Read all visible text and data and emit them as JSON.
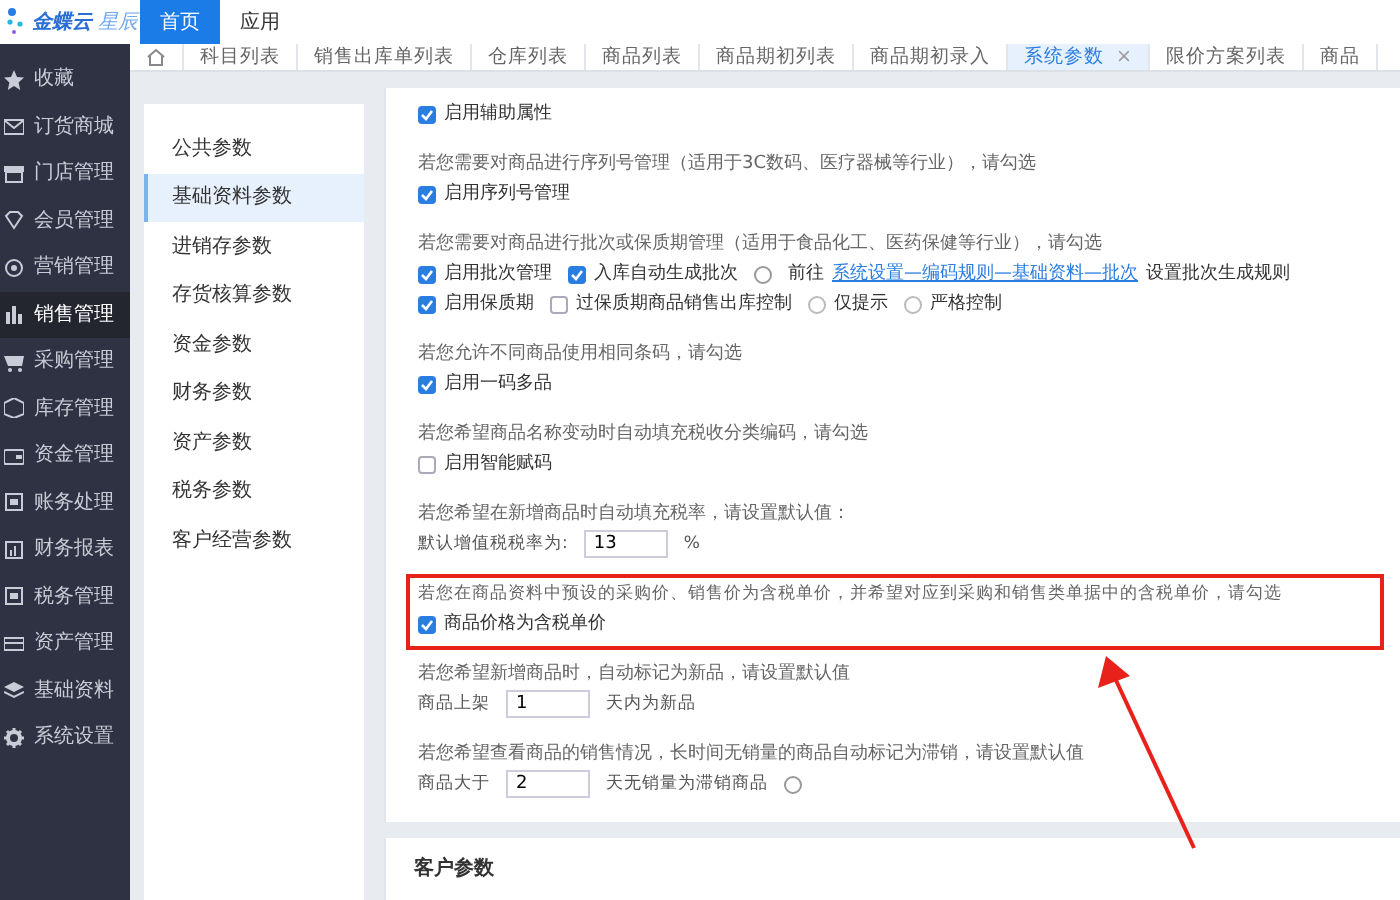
{
  "logo": {
    "name": "金蝶云",
    "edition": "星辰"
  },
  "top_tabs": [
    {
      "label": "首页",
      "selected": true
    },
    {
      "label": "应用",
      "selected": false
    }
  ],
  "sidebar": {
    "items": [
      {
        "label": "收藏",
        "selected": false
      },
      {
        "label": "订货商城",
        "selected": false
      },
      {
        "label": "门店管理",
        "selected": false
      },
      {
        "label": "会员管理",
        "selected": false
      },
      {
        "label": "营销管理",
        "selected": false
      },
      {
        "label": "销售管理",
        "selected": true
      },
      {
        "label": "采购管理",
        "selected": false
      },
      {
        "label": "库存管理",
        "selected": false
      },
      {
        "label": "资金管理",
        "selected": false
      },
      {
        "label": "账务处理",
        "selected": false
      },
      {
        "label": "财务报表",
        "selected": false
      },
      {
        "label": "税务管理",
        "selected": false
      },
      {
        "label": "资产管理",
        "selected": false
      },
      {
        "label": "基础资料",
        "selected": false
      },
      {
        "label": "系统设置",
        "selected": false
      }
    ]
  },
  "page_tabs": [
    {
      "label": "科目列表",
      "selected": false
    },
    {
      "label": "销售出库单列表",
      "selected": false
    },
    {
      "label": "仓库列表",
      "selected": false
    },
    {
      "label": "商品列表",
      "selected": false
    },
    {
      "label": "商品期初列表",
      "selected": false
    },
    {
      "label": "商品期初录入",
      "selected": false
    },
    {
      "label": "系统参数",
      "selected": true,
      "close": "×"
    },
    {
      "label": "限价方案列表",
      "selected": false
    },
    {
      "label": "商品",
      "selected": false
    }
  ],
  "param_nav": [
    {
      "label": "公共参数",
      "selected": false
    },
    {
      "label": "基础资料参数",
      "selected": true
    },
    {
      "label": "进销存参数",
      "selected": false
    },
    {
      "label": "存货核算参数",
      "selected": false
    },
    {
      "label": "资金参数",
      "selected": false
    },
    {
      "label": "财务参数",
      "selected": false
    },
    {
      "label": "资产参数",
      "selected": false
    },
    {
      "label": "税务参数",
      "selected": false
    },
    {
      "label": "客户经营参数",
      "selected": false
    }
  ],
  "settings": [
    {
      "rows": [
        [
          {
            "kind": "checkbox",
            "label": "启用辅助属性",
            "checked": true
          }
        ]
      ]
    },
    {
      "hint": "若您需要对商品进行序列号管理（适用于3C数码、医疗器械等行业），请勾选",
      "rows": [
        [
          {
            "kind": "checkbox",
            "label": "启用序列号管理",
            "checked": true
          }
        ]
      ]
    },
    {
      "hint": "若您需要对商品进行批次或保质期管理（适用于食品化工、医药保健等行业），请勾选",
      "rows": [
        [
          {
            "kind": "checkbox",
            "label": "启用批次管理",
            "checked": true
          },
          {
            "kind": "checkbox",
            "label": "入库自动生成批次",
            "checked": true
          },
          {
            "kind": "help"
          },
          {
            "kind": "link",
            "before": "前往",
            "link": "系统设置—编码规则—基础资料—批次",
            "after": "设置批次生成规则"
          }
        ],
        [
          {
            "kind": "checkbox",
            "label": "启用保质期",
            "checked": true
          },
          {
            "kind": "checkbox",
            "label": "过保质期商品销售出库控制",
            "checked": false
          },
          {
            "kind": "radio",
            "label": "仅提示",
            "selected": false
          },
          {
            "kind": "radio",
            "label": "严格控制",
            "selected": false
          }
        ]
      ]
    },
    {
      "hint": "若您允许不同商品使用相同条码，请勾选",
      "rows": [
        [
          {
            "kind": "checkbox",
            "label": "启用一码多品",
            "checked": true
          }
        ]
      ]
    },
    {
      "hint": "若您希望商品名称变动时自动填充税收分类编码，请勾选",
      "rows": [
        [
          {
            "kind": "checkbox",
            "label": "启用智能赋码",
            "checked": false
          }
        ]
      ]
    },
    {
      "hint": "若您希望在新增商品时自动填充税率，请设置默认值：",
      "rows": [
        [
          {
            "kind": "number",
            "label": "默认增值税税率为:",
            "value": "13",
            "unit": "%"
          }
        ]
      ]
    },
    {
      "hint": "若您在商品资料中预设的采购价、销售价为含税单价，并希望对应到采购和销售类单据中的含税单价，请勾选",
      "highlighted": true,
      "rows": [
        [
          {
            "kind": "checkbox",
            "label": "商品价格为含税单价",
            "checked": true
          }
        ]
      ]
    },
    {
      "hint": "若您希望新增商品时，自动标记为新品，请设置默认值",
      "rows": [
        [
          {
            "kind": "number",
            "label": "商品上架",
            "value": "1",
            "unit": "天内为新品"
          }
        ]
      ]
    },
    {
      "hint": "若您希望查看商品的销售情况，长时间无销量的商品自动标记为滞销，请设置默认值",
      "rows": [
        [
          {
            "kind": "number",
            "label": "商品大于",
            "value": "2",
            "unit": "天无销量为滞销商品"
          },
          {
            "kind": "help"
          }
        ]
      ]
    }
  ],
  "next_section": {
    "title": "客户参数"
  }
}
